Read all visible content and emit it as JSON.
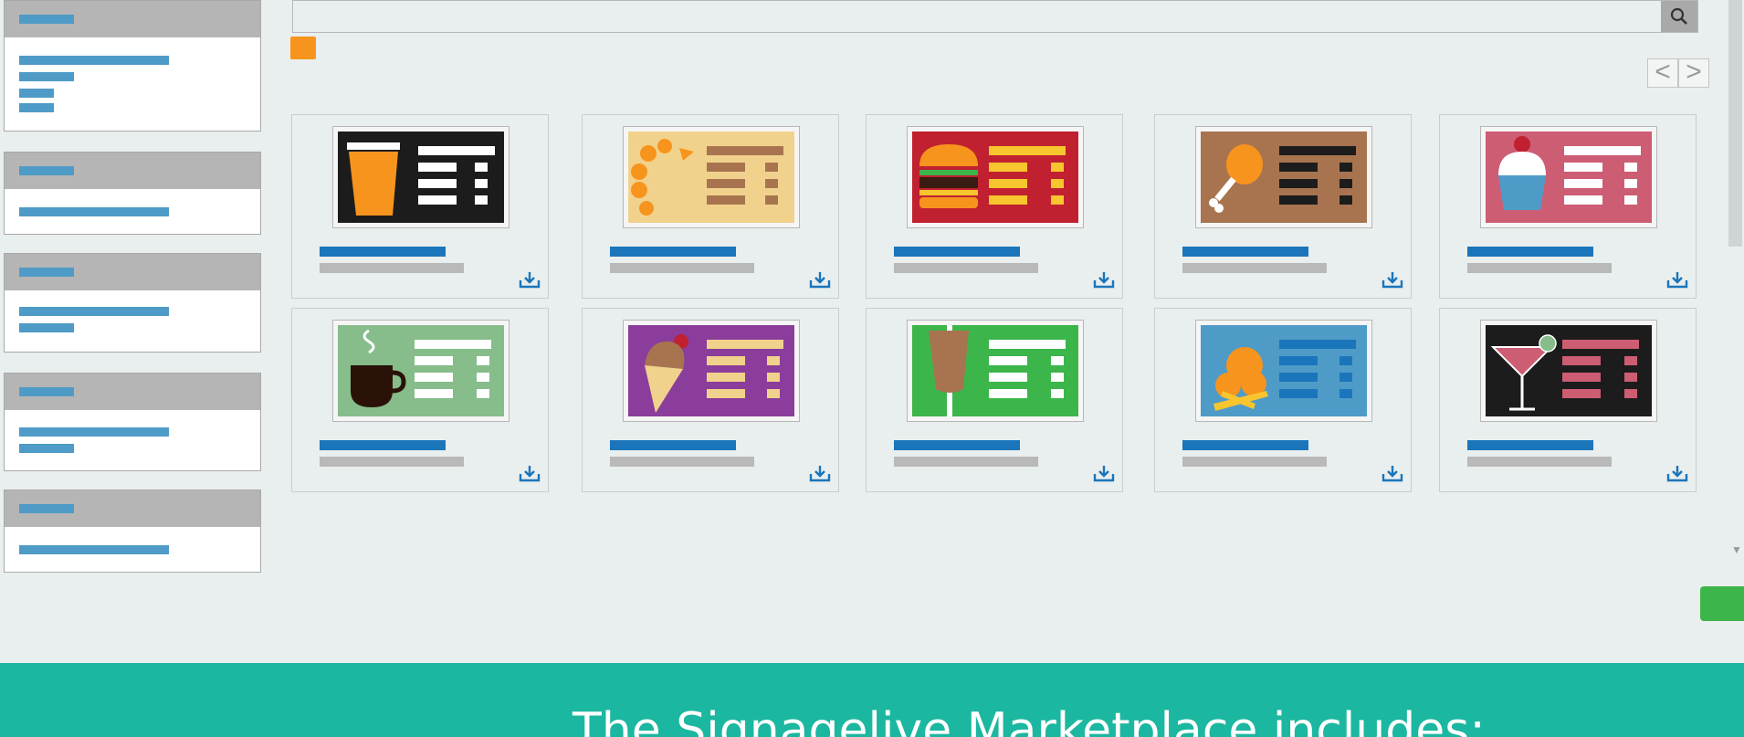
{
  "search": {
    "placeholder": ""
  },
  "pager": {
    "prev": "<",
    "next": ">"
  },
  "footer": {
    "text": "The Signagelive Marketplace includes:"
  },
  "colors": {
    "accent": "#1a75bb",
    "footer_bg": "#1bb7a0",
    "badge": "#f7941d",
    "action": "#3cb54a"
  },
  "templates": [
    {
      "theme": "drink-menu",
      "bg": "#1c1c1c",
      "icon": "cup-icon"
    },
    {
      "theme": "bakery-menu",
      "bg": "#f1d28c",
      "icon": "croissant-icon"
    },
    {
      "theme": "burger-menu",
      "bg": "#c0202f",
      "icon": "burger-icon"
    },
    {
      "theme": "chicken-menu",
      "bg": "#a8744f",
      "icon": "drumstick-icon"
    },
    {
      "theme": "cupcake-menu",
      "bg": "#cd5d73",
      "icon": "cupcake-icon"
    },
    {
      "theme": "coffee-menu",
      "bg": "#86bd8b",
      "icon": "coffee-icon"
    },
    {
      "theme": "icecream-menu",
      "bg": "#8b3d9b",
      "icon": "icecream-icon"
    },
    {
      "theme": "kebab-menu",
      "bg": "#3cb54a",
      "icon": "kebab-icon"
    },
    {
      "theme": "snack-menu",
      "bg": "#4f9bc7",
      "icon": "snack-icon"
    },
    {
      "theme": "cocktail-menu",
      "bg": "#1c1c1c",
      "icon": "cocktail-icon"
    }
  ]
}
